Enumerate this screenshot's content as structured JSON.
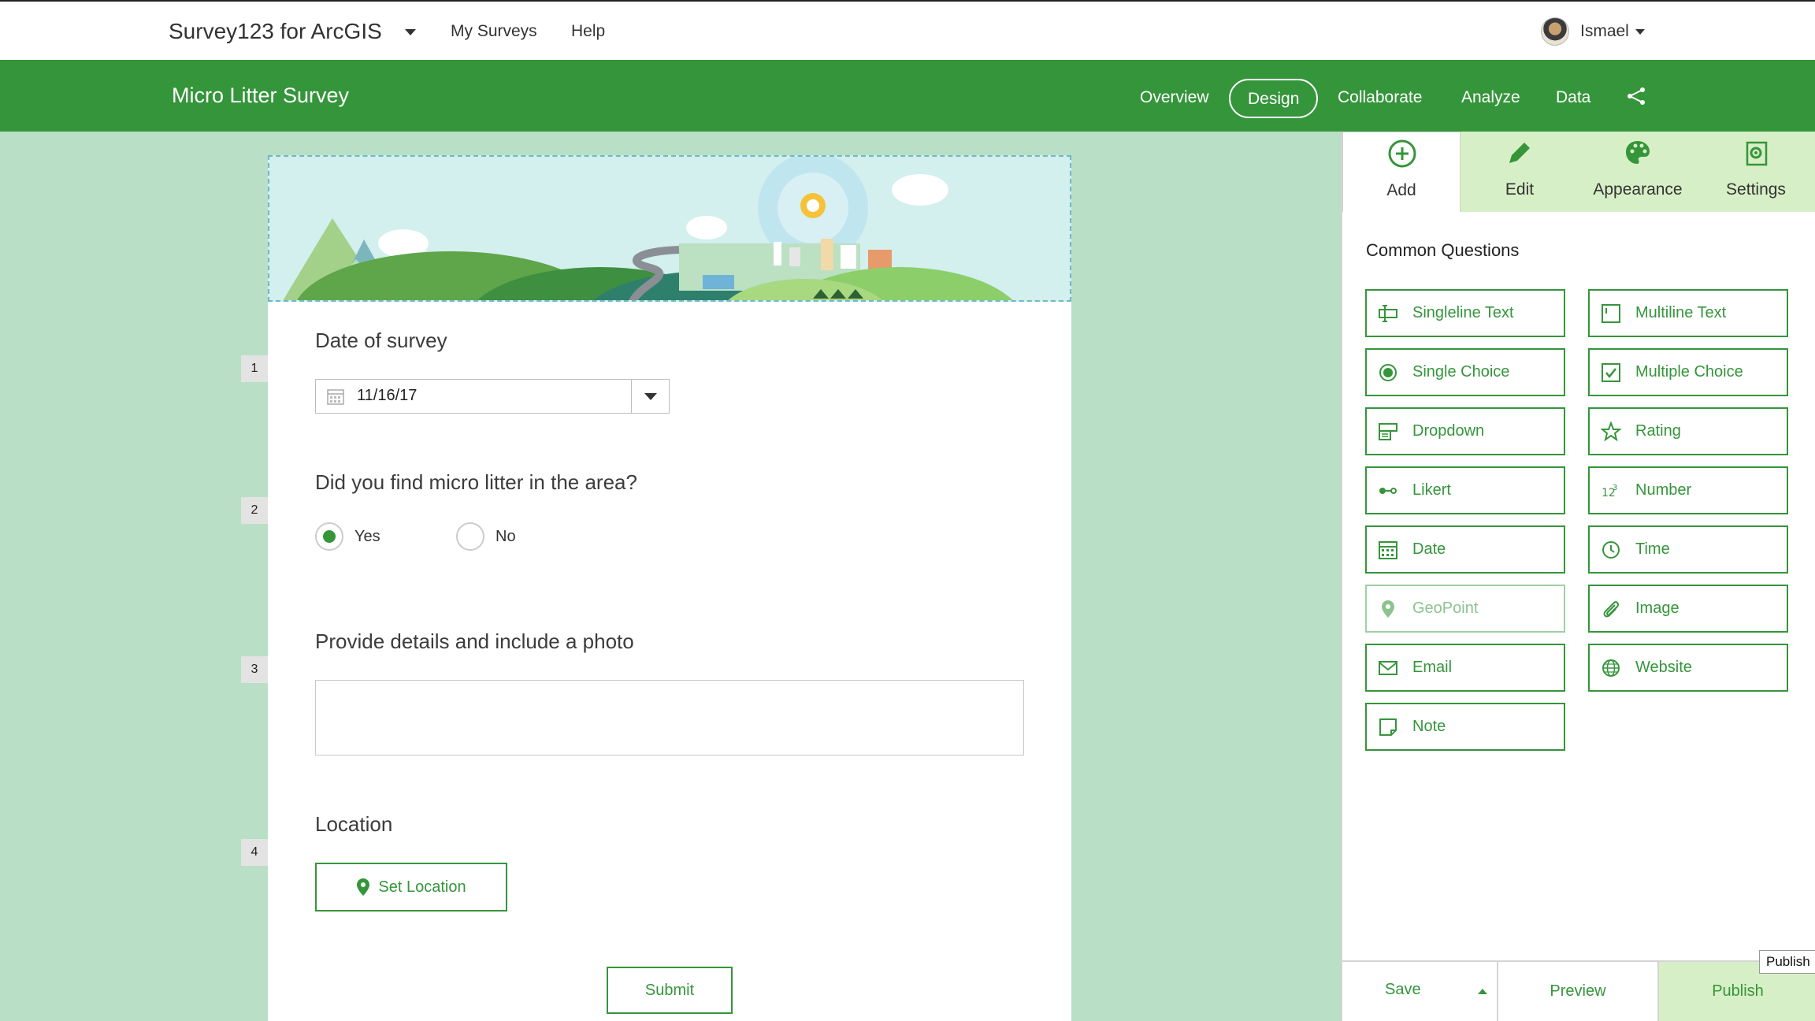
{
  "topbar": {
    "app_title": "Survey123 for ArcGIS",
    "links": [
      "My Surveys",
      "Help"
    ],
    "user_name": "Ismael"
  },
  "header": {
    "survey_title": "Micro Litter Survey",
    "tabs": [
      "Overview",
      "Design",
      "Collaborate",
      "Analyze",
      "Data"
    ],
    "active_tab": "Design",
    "share_icon": "share-network-icon"
  },
  "form": {
    "questions": [
      {
        "number": "1",
        "label": "Date of survey",
        "value": "11/16/17"
      },
      {
        "number": "2",
        "label": "Did you find micro litter in the area?",
        "options": [
          "Yes",
          "No"
        ],
        "selected": "Yes"
      },
      {
        "number": "3",
        "label": "Provide details and include a photo"
      },
      {
        "number": "4",
        "label": "Location",
        "button": "Set Location"
      }
    ],
    "submit_label": "Submit"
  },
  "panel": {
    "tabs": [
      {
        "label": "Add",
        "icon": "plus-circle-icon"
      },
      {
        "label": "Edit",
        "icon": "pencil-icon"
      },
      {
        "label": "Appearance",
        "icon": "palette-icon"
      },
      {
        "label": "Settings",
        "icon": "settings-gear-icon"
      }
    ],
    "active_tab": "Add",
    "section_title": "Common Questions",
    "questions": [
      {
        "label": "Singleline Text",
        "icon": "singleline-text-icon"
      },
      {
        "label": "Multiline Text",
        "icon": "multiline-text-icon"
      },
      {
        "label": "Single Choice",
        "icon": "radio-icon"
      },
      {
        "label": "Multiple Choice",
        "icon": "checkbox-icon"
      },
      {
        "label": "Dropdown",
        "icon": "dropdown-icon"
      },
      {
        "label": "Rating",
        "icon": "star-icon"
      },
      {
        "label": "Likert",
        "icon": "likert-icon"
      },
      {
        "label": "Number",
        "icon": "number-icon"
      },
      {
        "label": "Date",
        "icon": "calendar-icon"
      },
      {
        "label": "Time",
        "icon": "clock-icon"
      },
      {
        "label": "GeoPoint",
        "icon": "map-pin-icon",
        "disabled": true
      },
      {
        "label": "Image",
        "icon": "paperclip-icon"
      },
      {
        "label": "Email",
        "icon": "envelope-icon"
      },
      {
        "label": "Website",
        "icon": "globe-icon"
      },
      {
        "label": "Note",
        "icon": "note-icon"
      }
    ],
    "bottom": {
      "save": "Save",
      "preview": "Preview",
      "publish": "Publish"
    },
    "tooltip": "Publish"
  },
  "colors": {
    "brand_green": "#35953b",
    "canvas_bg": "#b9dfc6",
    "tab_bg": "#d7efc6"
  }
}
